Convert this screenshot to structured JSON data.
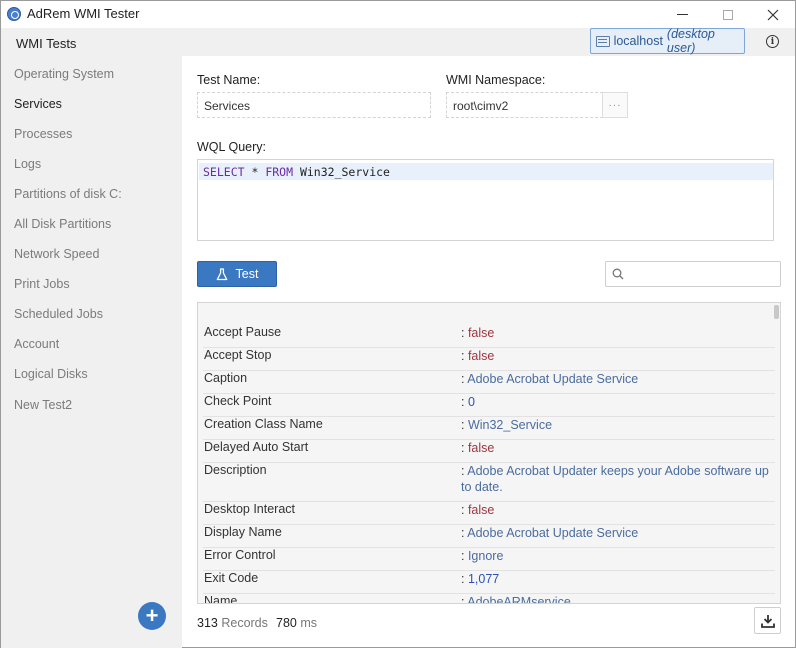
{
  "window": {
    "title": "AdRem WMI Tester"
  },
  "header": {
    "title": "WMI Tests",
    "host": "localhost",
    "host_user": "(desktop user)"
  },
  "sidebar": {
    "items": [
      {
        "label": "Operating System",
        "active": false
      },
      {
        "label": "Services",
        "active": true
      },
      {
        "label": "Processes",
        "active": false
      },
      {
        "label": "Logs",
        "active": false
      },
      {
        "label": "Partitions of disk C:",
        "active": false
      },
      {
        "label": "All Disk Partitions",
        "active": false
      },
      {
        "label": "Network Speed",
        "active": false
      },
      {
        "label": "Print Jobs",
        "active": false
      },
      {
        "label": "Scheduled Jobs",
        "active": false
      },
      {
        "label": "Account",
        "active": false
      },
      {
        "label": "Logical Disks",
        "active": false
      },
      {
        "label": "New Test2",
        "active": false
      }
    ],
    "add_label": "+"
  },
  "form": {
    "test_name_label": "Test Name:",
    "test_name_value": "Services",
    "namespace_label": "WMI Namespace:",
    "namespace_value": "root\\cimv2",
    "browse_label": "···",
    "query_label": "WQL Query:",
    "query": {
      "kw1": "SELECT",
      "star": " * ",
      "kw2": "FROM",
      "table": " Win32_Service"
    }
  },
  "actions": {
    "test_label": "Test",
    "search_placeholder": ""
  },
  "results": {
    "rows": [
      {
        "key": "Accept Pause",
        "value": "false",
        "kind": "bool"
      },
      {
        "key": "Accept Stop",
        "value": "false",
        "kind": "bool"
      },
      {
        "key": "Caption",
        "value": "Adobe Acrobat Update Service",
        "kind": "str"
      },
      {
        "key": "Check Point",
        "value": "0",
        "kind": "num"
      },
      {
        "key": "Creation Class Name",
        "value": "Win32_Service",
        "kind": "str"
      },
      {
        "key": "Delayed Auto Start",
        "value": "false",
        "kind": "bool"
      },
      {
        "key": "Description",
        "value": "Adobe Acrobat Updater keeps your Adobe software up to date.",
        "kind": "str"
      },
      {
        "key": "Desktop Interact",
        "value": "false",
        "kind": "bool"
      },
      {
        "key": "Display Name",
        "value": "Adobe Acrobat Update Service",
        "kind": "str"
      },
      {
        "key": "Error Control",
        "value": "Ignore",
        "kind": "str"
      },
      {
        "key": "Exit Code",
        "value": "1,077",
        "kind": "num"
      },
      {
        "key": "Name",
        "value": "AdobeARMservice",
        "kind": "str"
      }
    ]
  },
  "status": {
    "records_count": "313",
    "records_label": "Records",
    "time_value": "780",
    "time_unit": "ms"
  },
  "colors": {
    "accent": "#3a78c2",
    "bool_value": "#9b3640",
    "string_value": "#4b6c9e",
    "number_value": "#2c52b8"
  }
}
